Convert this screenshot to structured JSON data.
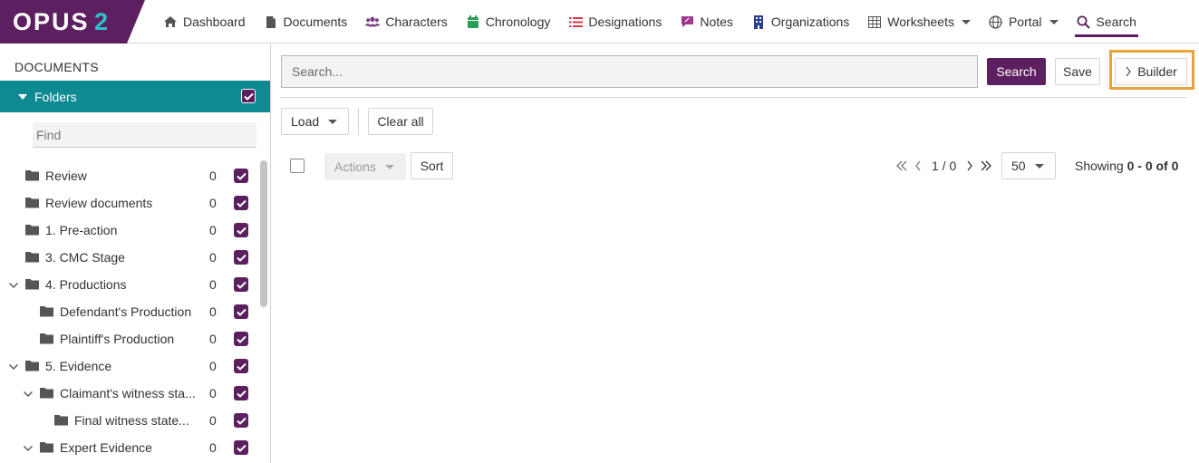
{
  "brand": {
    "logo_text": "OPUS",
    "logo_number": "2",
    "logo_color": "#5c1f5f",
    "logo_accent": "#2bc4c9"
  },
  "nav": {
    "items": [
      {
        "id": "dashboard",
        "label": "Dashboard",
        "icon": "home-icon",
        "color": "#555555"
      },
      {
        "id": "documents",
        "label": "Documents",
        "icon": "document-icon",
        "color": "#555555"
      },
      {
        "id": "characters",
        "label": "Characters",
        "icon": "users-icon",
        "color": "#7b3f86"
      },
      {
        "id": "chronology",
        "label": "Chronology",
        "icon": "calendar-icon",
        "color": "#2e9d57"
      },
      {
        "id": "designations",
        "label": "Designations",
        "icon": "list-icon",
        "color": "#d6394c"
      },
      {
        "id": "notes",
        "label": "Notes",
        "icon": "note-icon",
        "color": "#a0398e"
      },
      {
        "id": "organizations",
        "label": "Organizations",
        "icon": "building-icon",
        "color": "#2c3e8f"
      },
      {
        "id": "worksheets",
        "label": "Worksheets",
        "icon": "table-icon",
        "color": "#555555",
        "dropdown": true
      },
      {
        "id": "portal",
        "label": "Portal",
        "icon": "globe-icon",
        "color": "#555555",
        "dropdown": true
      },
      {
        "id": "search",
        "label": "Search",
        "icon": "search-icon",
        "color": "#5c1f5f",
        "active": true
      }
    ]
  },
  "sidebar": {
    "heading": "DOCUMENTS",
    "folders_label": "Folders",
    "find_placeholder": "Find",
    "tree": [
      {
        "name": "Review",
        "count": "0",
        "level": 0,
        "expanded": false
      },
      {
        "name": "Review documents",
        "count": "0",
        "level": 0,
        "expanded": false
      },
      {
        "name": "1. Pre-action",
        "count": "0",
        "level": 0,
        "expanded": false
      },
      {
        "name": "3. CMC Stage",
        "count": "0",
        "level": 0,
        "expanded": false
      },
      {
        "name": "4. Productions",
        "count": "0",
        "level": 0,
        "expanded": true
      },
      {
        "name": "Defendant's Production",
        "count": "0",
        "level": 1,
        "expanded": false
      },
      {
        "name": "Plaintiff's Production",
        "count": "0",
        "level": 1,
        "expanded": false
      },
      {
        "name": "5. Evidence",
        "count": "0",
        "level": 0,
        "expanded": true
      },
      {
        "name": "Claimant's witness sta...",
        "count": "0",
        "level": 1,
        "expanded": true
      },
      {
        "name": "Final witness state...",
        "count": "0",
        "level": 2,
        "expanded": false
      },
      {
        "name": "Expert Evidence",
        "count": "0",
        "level": 1,
        "expanded": true
      }
    ]
  },
  "main": {
    "search_placeholder": "Search...",
    "search_button": "Search",
    "save_button": "Save",
    "builder_button": "Builder",
    "load_button": "Load",
    "clear_all_button": "Clear all",
    "actions_button": "Actions",
    "sort_button": "Sort",
    "page_current": "1",
    "page_total": "0",
    "page_text": "1 / 0",
    "per_page": "50",
    "showing_prefix": "Showing",
    "showing_range": "0 - 0 of 0"
  }
}
